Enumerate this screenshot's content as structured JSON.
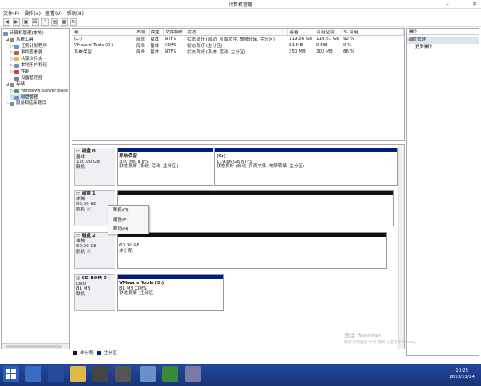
{
  "window": {
    "title": "计算机管理",
    "min": "–",
    "max": "□",
    "close": "✕"
  },
  "menu": [
    "文件(F)",
    "操作(A)",
    "查看(V)",
    "帮助(H)"
  ],
  "tree": [
    {
      "label": "计算机管理(本地)",
      "level": 0,
      "expand": "",
      "icon": "computer-icon",
      "color": "#6a8fc7"
    },
    {
      "label": "系统工具",
      "level": 1,
      "expand": "◢",
      "icon": "tools-icon",
      "color": "#8a8a8a"
    },
    {
      "label": "任务计划程序",
      "level": 2,
      "expand": "▷",
      "icon": "clock-icon",
      "color": "#5aa0d8"
    },
    {
      "label": "事件查看器",
      "level": 2,
      "expand": "▷",
      "icon": "event-viewer-icon",
      "color": "#c85a3a"
    },
    {
      "label": "共享文件夹",
      "level": 2,
      "expand": "▷",
      "icon": "folder-icon",
      "color": "#e0b84a"
    },
    {
      "label": "本地用户和组",
      "level": 2,
      "expand": "▷",
      "icon": "users-icon",
      "color": "#6b8fd0"
    },
    {
      "label": "性能",
      "level": 2,
      "expand": "▷",
      "icon": "performance-icon",
      "color": "#c94040"
    },
    {
      "label": "设备管理器",
      "level": 2,
      "expand": "",
      "icon": "device-manager-icon",
      "color": "#7c7c9c"
    },
    {
      "label": "存储",
      "level": 1,
      "expand": "◢",
      "icon": "storage-icon",
      "color": "#8a8a8a"
    },
    {
      "label": "Windows Server Back",
      "level": 2,
      "expand": "▷",
      "icon": "backup-icon",
      "color": "#4e9a4e"
    },
    {
      "label": "磁盘管理",
      "level": 2,
      "expand": "",
      "icon": "disk-icon",
      "color": "#6a8fc7"
    },
    {
      "label": "服务和应用程序",
      "level": 1,
      "expand": "▷",
      "icon": "services-icon",
      "color": "#8a8a8a"
    }
  ],
  "volumes": {
    "headers": [
      "卷",
      "布局",
      "类型",
      "文件系统",
      "状态",
      "容量",
      "可用空间",
      "% 可用"
    ],
    "rows": [
      [
        "(C:)",
        "简单",
        "基本",
        "NTFS",
        "状态良好 (启动, 页面文件, 故障转储, 主分区)",
        "119.66 GB",
        "110.61 GB",
        "92 %"
      ],
      [
        "VMware Tools (D:)",
        "简单",
        "基本",
        "CDFS",
        "状态良好 (主分区)",
        "81 MB",
        "0 MB",
        "0 %"
      ],
      [
        "系统保留",
        "简单",
        "基本",
        "NTFS",
        "状态良好 (系统, 活动, 主分区)",
        "350 MB",
        "302 MB",
        "86 %"
      ]
    ]
  },
  "disks": {
    "disk0": {
      "name": "磁盘 0",
      "type": "基本",
      "size": "120.00 GB",
      "status": "联机",
      "p1": {
        "name": "系统保留",
        "size": "350 MB NTFS",
        "status": "状态良好 (系统, 活动, 主分区)"
      },
      "p2": {
        "name": "(C:)",
        "size": "119.66 GB NTFS",
        "status": "状态良好 (启动, 页面文件, 故障转储, 主分区)"
      }
    },
    "disk1": {
      "name": "磁盘 1",
      "type": "未知",
      "size": "80.00 GB",
      "status": "脱机",
      "info": "ⓘ"
    },
    "disk2": {
      "name": "磁盘 2",
      "type": "未知",
      "size": "60.00 GB",
      "status": "脱机",
      "info": "ⓘ",
      "p1": {
        "size": "60.00 GB",
        "status": "未分配"
      }
    },
    "cdrom": {
      "name": "CD-ROM 0",
      "type": "DVD",
      "size": "81 MB",
      "status": "联机",
      "p1": {
        "name": "VMware Tools (D:)",
        "size": "81 MB CDFS",
        "status": "状态良好 (主分区)"
      }
    }
  },
  "context_menu": [
    "联机(O)",
    "属性(P)",
    "帮助(H)"
  ],
  "legend": [
    {
      "label": "未分配",
      "color": "#111111"
    },
    {
      "label": "主分区",
      "color": "#001e7c"
    }
  ],
  "actions": {
    "header": "操作",
    "section": "磁盘管理",
    "more": "更多操作"
  },
  "watermark": {
    "title": "激活 Windows",
    "sub": "转到\"控制面板\"中的\"系统\"以激活 Windows。"
  },
  "clock": {
    "time": "10:25",
    "date": "2013/12/24"
  }
}
